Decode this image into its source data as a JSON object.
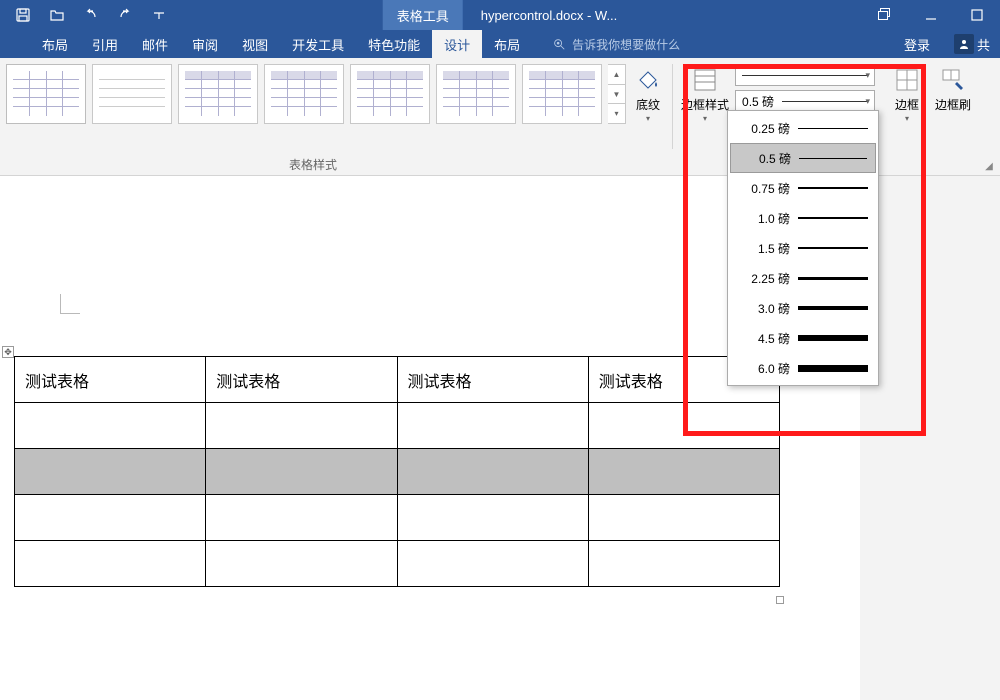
{
  "titlebar": {
    "context_tab": "表格工具",
    "doc_title": "hypercontrol.docx - W..."
  },
  "tabs": {
    "items": [
      "布局",
      "引用",
      "邮件",
      "审阅",
      "视图",
      "开发工具",
      "特色功能",
      "设计",
      "布局"
    ],
    "active_index": 7,
    "tell_me_placeholder": "告诉我你想要做什么",
    "login": "登录",
    "share": "共"
  },
  "ribbon": {
    "styles_group_label": "表格样式",
    "shading": "底纹",
    "border_style": "边框样式",
    "border_weight_current": "0.5 磅",
    "borders": "边框",
    "border_painter": "边框刷"
  },
  "weight_options": [
    {
      "label": "0.25 磅",
      "w": 0.5
    },
    {
      "label": "0.5 磅",
      "w": 1
    },
    {
      "label": "0.75 磅",
      "w": 1.2
    },
    {
      "label": "1.0 磅",
      "w": 1.6
    },
    {
      "label": "1.5 磅",
      "w": 2.2
    },
    {
      "label": "2.25 磅",
      "w": 3
    },
    {
      "label": "3.0 磅",
      "w": 4
    },
    {
      "label": "4.5 磅",
      "w": 5.5
    },
    {
      "label": "6.0 磅",
      "w": 7
    }
  ],
  "weight_selected_index": 1,
  "doc_table": {
    "cell_text": "测试表格",
    "rows": 5,
    "cols": 4,
    "header_row": 0,
    "selected_row": 2
  }
}
